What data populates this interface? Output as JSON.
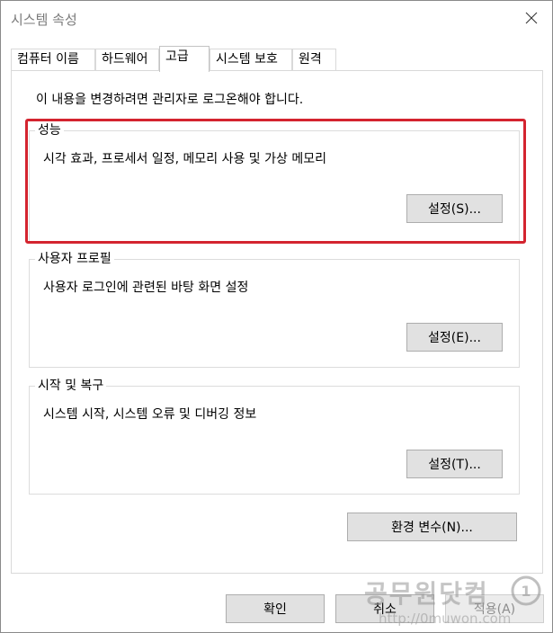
{
  "window": {
    "title": "시스템 속성"
  },
  "tabs": [
    "컴퓨터 이름",
    "하드웨어",
    "고급",
    "시스템 보호",
    "원격"
  ],
  "active_tab_index": 2,
  "notice": "이 내용을 변경하려면 관리자로 로그온해야 합니다.",
  "groups": {
    "performance": {
      "title": "성능",
      "description": "시각 효과, 프로세서 일정, 메모리 사용 및 가상 메모리",
      "button": "설정(S)..."
    },
    "user_profiles": {
      "title": "사용자 프로필",
      "description": "사용자 로그인에 관련된 바탕 화면 설정",
      "button": "설정(E)..."
    },
    "startup_recovery": {
      "title": "시작 및 복구",
      "description": "시스템 시작, 시스템 오류 및 디버깅 정보",
      "button": "설정(T)..."
    }
  },
  "env_button": "환경 변수(N)...",
  "footer": {
    "ok": "확인",
    "cancel": "취소",
    "apply": "적용(A)"
  },
  "watermark": {
    "name": "공무원닷컴",
    "url": "http://0muwon.com"
  },
  "colors": {
    "highlight": "#d4242f",
    "button_bg": "#e1e1e1",
    "button_border": "#adadad",
    "title_gray": "#7a7a7a"
  },
  "icons": {
    "close": "close-icon",
    "watermark_logo": "watermark-logo-icon"
  }
}
